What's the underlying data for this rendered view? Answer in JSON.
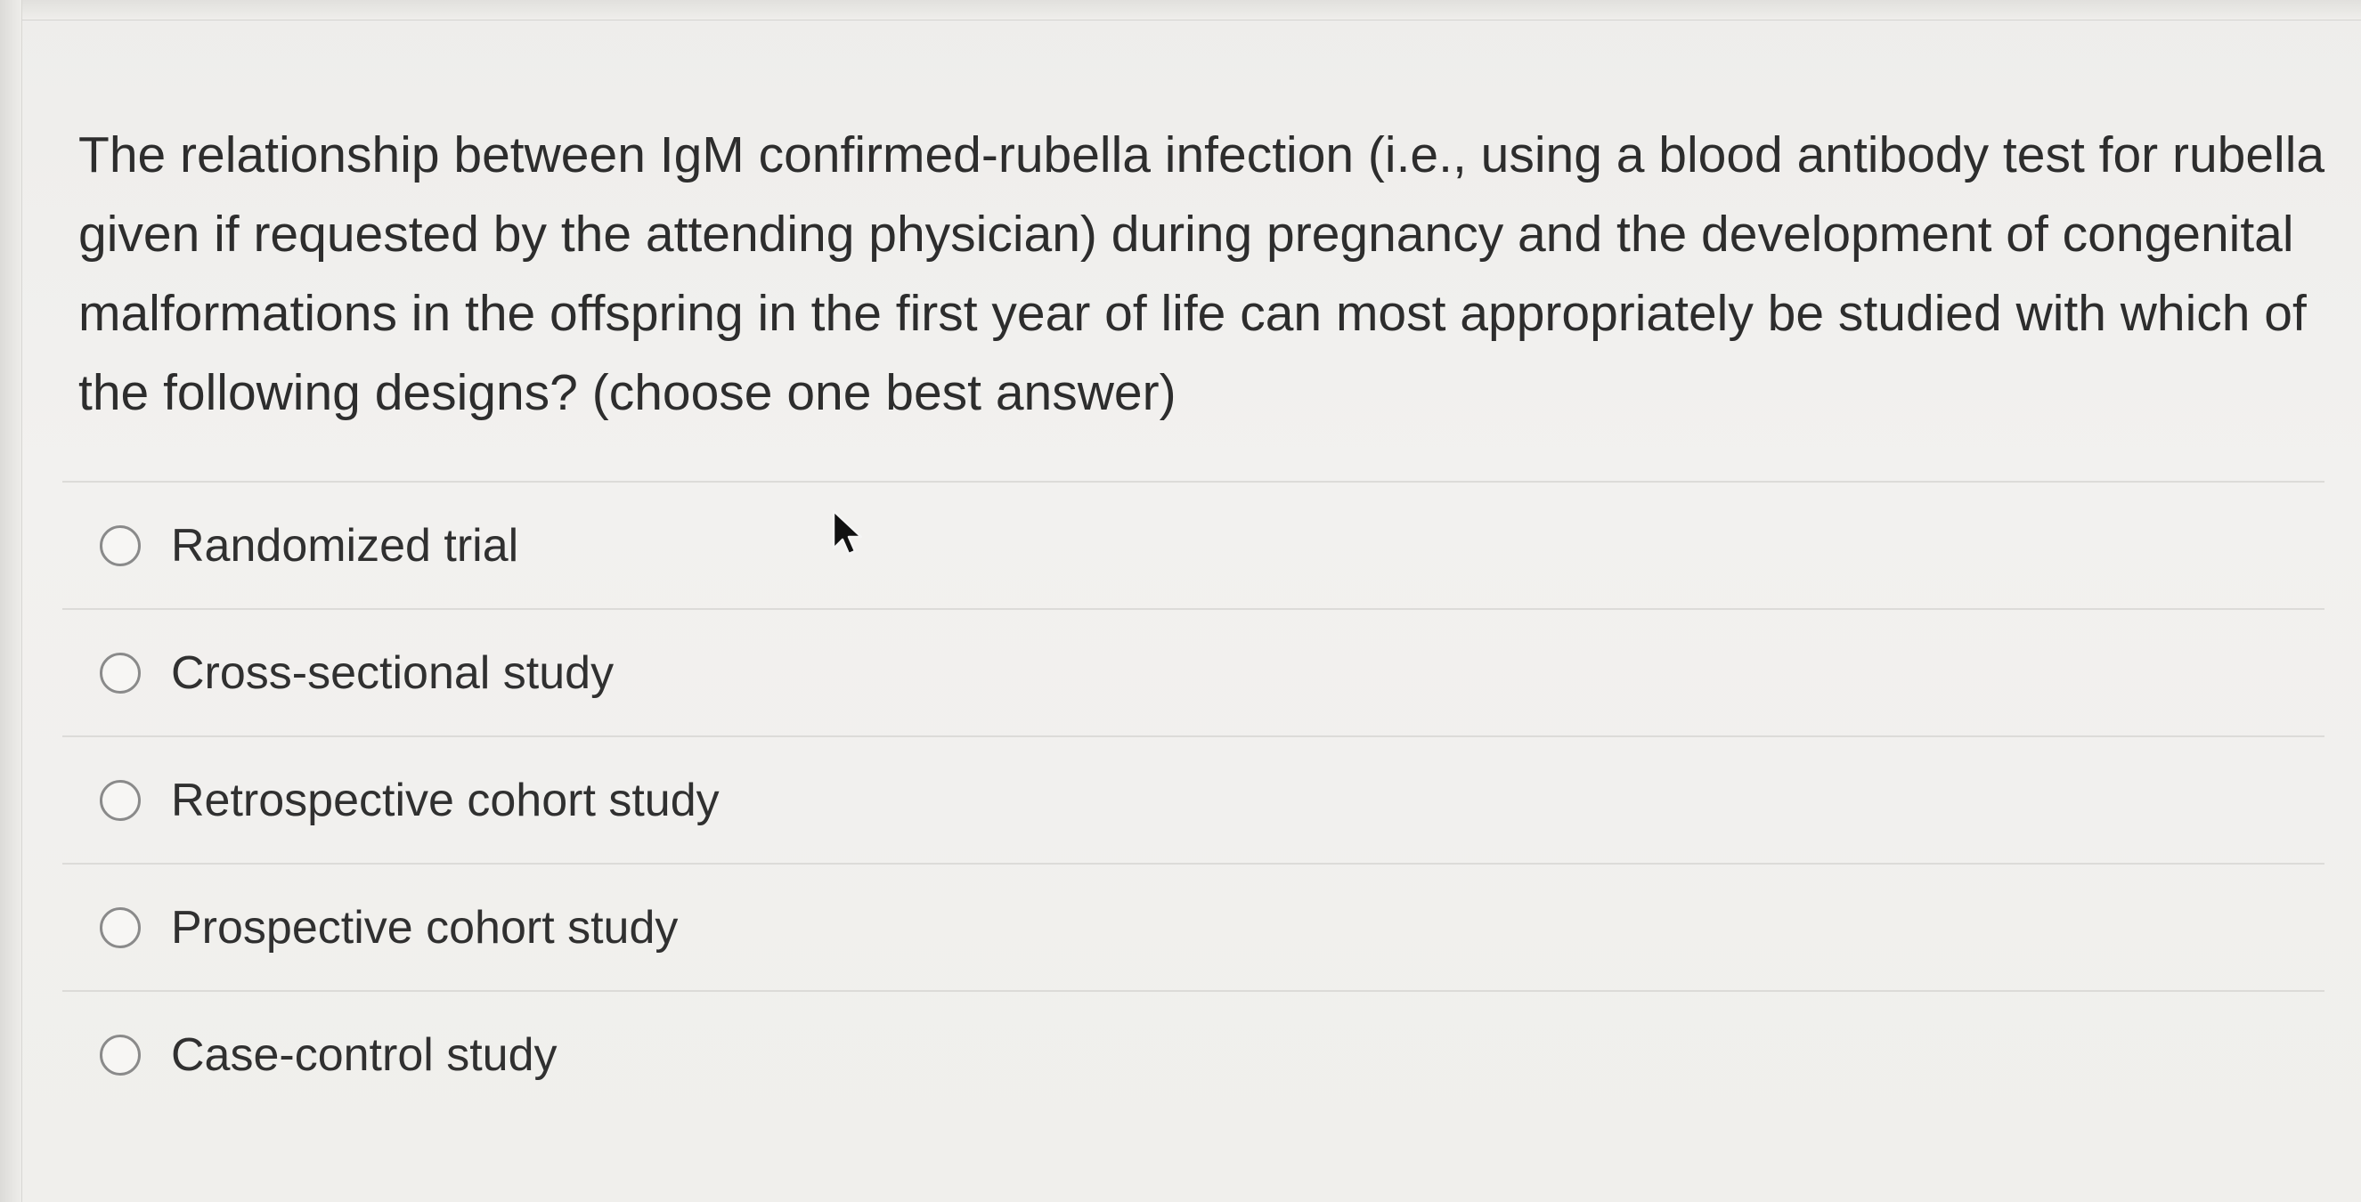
{
  "question": {
    "text": "The relationship between IgM confirmed-rubella infection (i.e., using a blood antibody test for rubella given if requested by the attending physician) during pregnancy and the development of congenital malformations in the offspring in the first year of life can most appropriately be studied with which of the following designs? (choose one best answer)"
  },
  "options": [
    {
      "label": "Randomized trial",
      "selected": false
    },
    {
      "label": "Cross-sectional study",
      "selected": false
    },
    {
      "label": "Retrospective cohort study",
      "selected": false
    },
    {
      "label": "Prospective cohort study",
      "selected": false
    },
    {
      "label": "Case-control study",
      "selected": false
    }
  ],
  "icons": {
    "cursor": "mouse-pointer-icon",
    "radio": "radio-unchecked-icon"
  },
  "colors": {
    "background": "#f0efed",
    "text": "#2d2d2d",
    "divider": "#dcdbd8",
    "radio_border": "#8a8a8a"
  }
}
